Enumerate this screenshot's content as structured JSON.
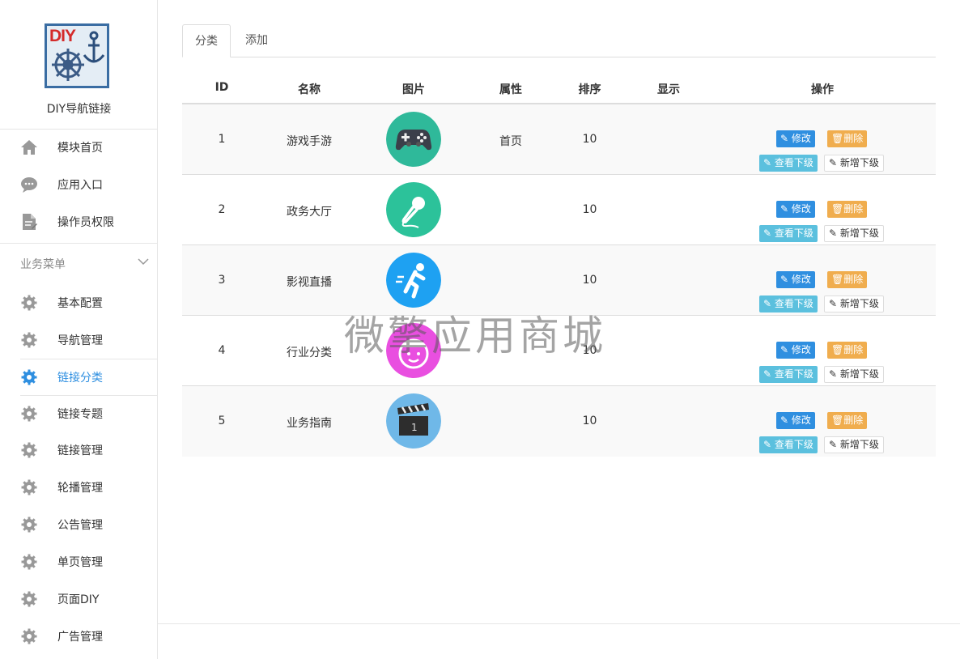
{
  "app": {
    "name": "DIY导航链接",
    "logo_text": "DIY"
  },
  "sidebar": {
    "top_items": [
      {
        "label": "模块首页",
        "icon": "home-icon"
      },
      {
        "label": "应用入口",
        "icon": "chat-icon"
      },
      {
        "label": "操作员权限",
        "icon": "document-icon"
      }
    ],
    "section_title": "业务菜单",
    "items": [
      {
        "label": "基本配置",
        "icon": "gear-icon"
      },
      {
        "label": "导航管理",
        "icon": "gear-icon"
      },
      {
        "label": "链接分类",
        "icon": "gear-icon",
        "active": true
      },
      {
        "label": "链接专题",
        "icon": "gear-icon"
      },
      {
        "label": "链接管理",
        "icon": "gear-icon"
      },
      {
        "label": "轮播管理",
        "icon": "gear-icon"
      },
      {
        "label": "公告管理",
        "icon": "gear-icon"
      },
      {
        "label": "单页管理",
        "icon": "gear-icon"
      },
      {
        "label": "页面DIY",
        "icon": "gear-icon"
      },
      {
        "label": "广告管理",
        "icon": "gear-icon"
      }
    ]
  },
  "tabs": [
    {
      "label": "分类",
      "active": true
    },
    {
      "label": "添加"
    }
  ],
  "table": {
    "headers": {
      "id": "ID",
      "name": "名称",
      "image": "图片",
      "attr": "属性",
      "sort": "排序",
      "show": "显示",
      "op": "操作"
    },
    "rows": [
      {
        "id": "1",
        "name": "游戏手游",
        "attr": "首页",
        "sort": "10",
        "show": "",
        "image": "gamepad-icon"
      },
      {
        "id": "2",
        "name": "政务大厅",
        "attr": "",
        "sort": "10",
        "show": "",
        "image": "microphone-icon"
      },
      {
        "id": "3",
        "name": "影视直播",
        "attr": "",
        "sort": "10",
        "show": "",
        "image": "runner-icon"
      },
      {
        "id": "4",
        "name": "行业分类",
        "attr": "",
        "sort": "10",
        "show": "",
        "image": "face-icon"
      },
      {
        "id": "5",
        "name": "业务指南",
        "attr": "",
        "sort": "10",
        "show": "",
        "image": "clapperboard-icon"
      }
    ],
    "buttons": {
      "edit": "修改",
      "delete": "删除",
      "view": "查看下级",
      "add": "新增下级"
    }
  },
  "watermark": "微擎应用商城",
  "colors": {
    "primary": "#2f8fe0",
    "warning": "#f0ad4e",
    "info": "#5bc0de"
  }
}
